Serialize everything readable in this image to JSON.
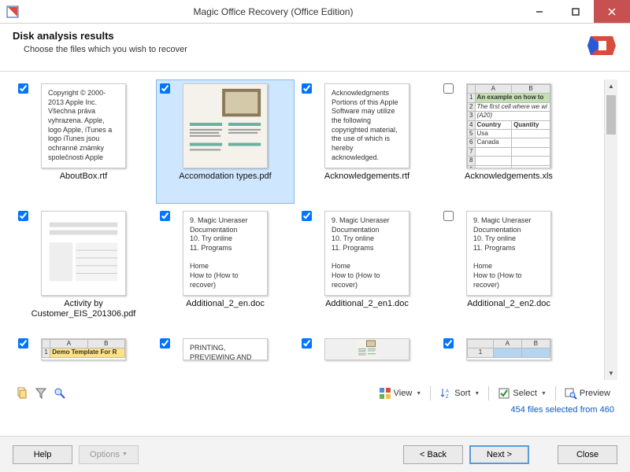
{
  "window": {
    "title": "Magic Office Recovery (Office Edition)"
  },
  "header": {
    "title": "Disk analysis results",
    "subtitle": "Choose the files which you wish to recover"
  },
  "files": [
    {
      "checked": true,
      "name": "AboutBox.rtf",
      "kind": "text",
      "text": "Copyright © 2000-2013 Apple Inc. Všechna práva vyhrazena. Apple, logo Apple, iTunes a logo iTunes jsou ochranné známky společnosti Apple"
    },
    {
      "checked": true,
      "name": "Accomodation types.pdf",
      "kind": "image",
      "selected": true
    },
    {
      "checked": true,
      "name": "Acknowledgements.rtf",
      "kind": "text",
      "text": "Acknowledgments Portions of this Apple Software may utilize the following copyrighted material, the use of which is hereby acknowledged."
    },
    {
      "checked": false,
      "name": "Acknowledgements.xls",
      "kind": "xls1"
    },
    {
      "checked": true,
      "name": "Activity by Customer_EIS_201306.pdf",
      "kind": "image2"
    },
    {
      "checked": true,
      "name": "Additional_2_en.doc",
      "kind": "text",
      "text": "9. Magic Uneraser Documentation\n10. Try online\n11. Programs\n\nHome\nHow to (How to recover)"
    },
    {
      "checked": true,
      "name": "Additional_2_en1.doc",
      "kind": "text",
      "text": "9. Magic Uneraser Documentation\n10. Try online\n11. Programs\n\nHome\nHow to (How to recover)"
    },
    {
      "checked": false,
      "name": "Additional_2_en2.doc",
      "kind": "text",
      "text": "9. Magic Uneraser Documentation\n10. Try online\n11. Programs\n\nHome\nHow to (How to recover)"
    },
    {
      "checked": true,
      "name": "",
      "kind": "xls2",
      "cut": true
    },
    {
      "checked": true,
      "name": "",
      "kind": "text",
      "cut": true,
      "text": "PRINTING, PREVIEWING AND"
    },
    {
      "checked": true,
      "name": "",
      "kind": "image",
      "cut": true
    },
    {
      "checked": true,
      "name": "",
      "kind": "xls3",
      "cut": true
    }
  ],
  "xls1": {
    "cols": [
      "",
      "A",
      "B"
    ],
    "r1": "An example on how to",
    "r2": "The first cell where we wi",
    "r3": "(A20)",
    "r4a": "Country",
    "r4b": "Quantity",
    "r5a": "Usa",
    "r6a": "Canada"
  },
  "xls2": {
    "a1": "Demo Template For R"
  },
  "toolbar": {
    "view": "View",
    "sort": "Sort",
    "select": "Select",
    "preview": "Preview"
  },
  "status": "454 files selected from 460",
  "footer": {
    "help": "Help",
    "options": "Options",
    "back": "< Back",
    "next": "Next >",
    "close": "Close"
  }
}
